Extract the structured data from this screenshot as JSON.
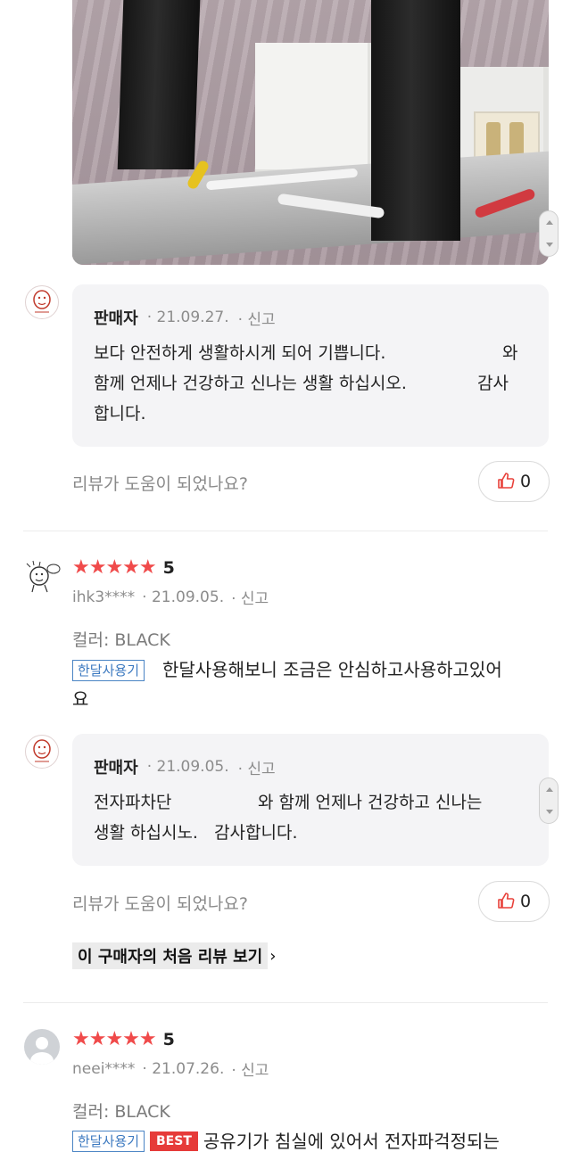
{
  "photo": {
    "expand_icon": "expand-icon"
  },
  "reply1": {
    "seller": "판매자",
    "date": "21.09.27.",
    "report": "신고",
    "text_line1": "보다 안전하게 생활하시게 되어 기쁩니다.",
    "text_line1_end": "와",
    "text_line2": "함께 언제나 건강하고 신나는 생활 하십시오.",
    "text_line2_end": "감사",
    "text_line3": "합니다."
  },
  "helpful1": {
    "question": "리뷰가 도움이 되었나요?",
    "count": "0"
  },
  "review1": {
    "rating": "5",
    "user": "ihk3****",
    "date": "21.09.05.",
    "report": "신고",
    "option": "컬러: BLACK",
    "tag": "한달사용기",
    "text_line1": "한달사용해보니 조금은 안심하고사용하고있어",
    "text_line2": "요"
  },
  "reply2": {
    "seller": "판매자",
    "date": "21.09.05.",
    "report": "신고",
    "text_line1_start": "전자파차단",
    "text_line1_end": "와 함께 언제나 건강하고 신나는",
    "text_line2": "생활 하십시노.   감사합니다."
  },
  "helpful2": {
    "question": "리뷰가 도움이 되었나요?",
    "count": "0"
  },
  "first_review_link": "이 구매자의 처음 리뷰 보기",
  "review2": {
    "rating": "5",
    "user": "neei****",
    "date": "21.07.26.",
    "report": "신고",
    "option": "컬러: BLACK",
    "tag": "한달사용기",
    "tag_best": "BEST",
    "text_line1": "공유기가 침실에 있어서 전자파걱정되는"
  },
  "colors": {
    "star": "#f04a4a",
    "like_icon": "#e8413a",
    "tag_border": "#4a84c4",
    "best_bg": "#e63b39"
  }
}
